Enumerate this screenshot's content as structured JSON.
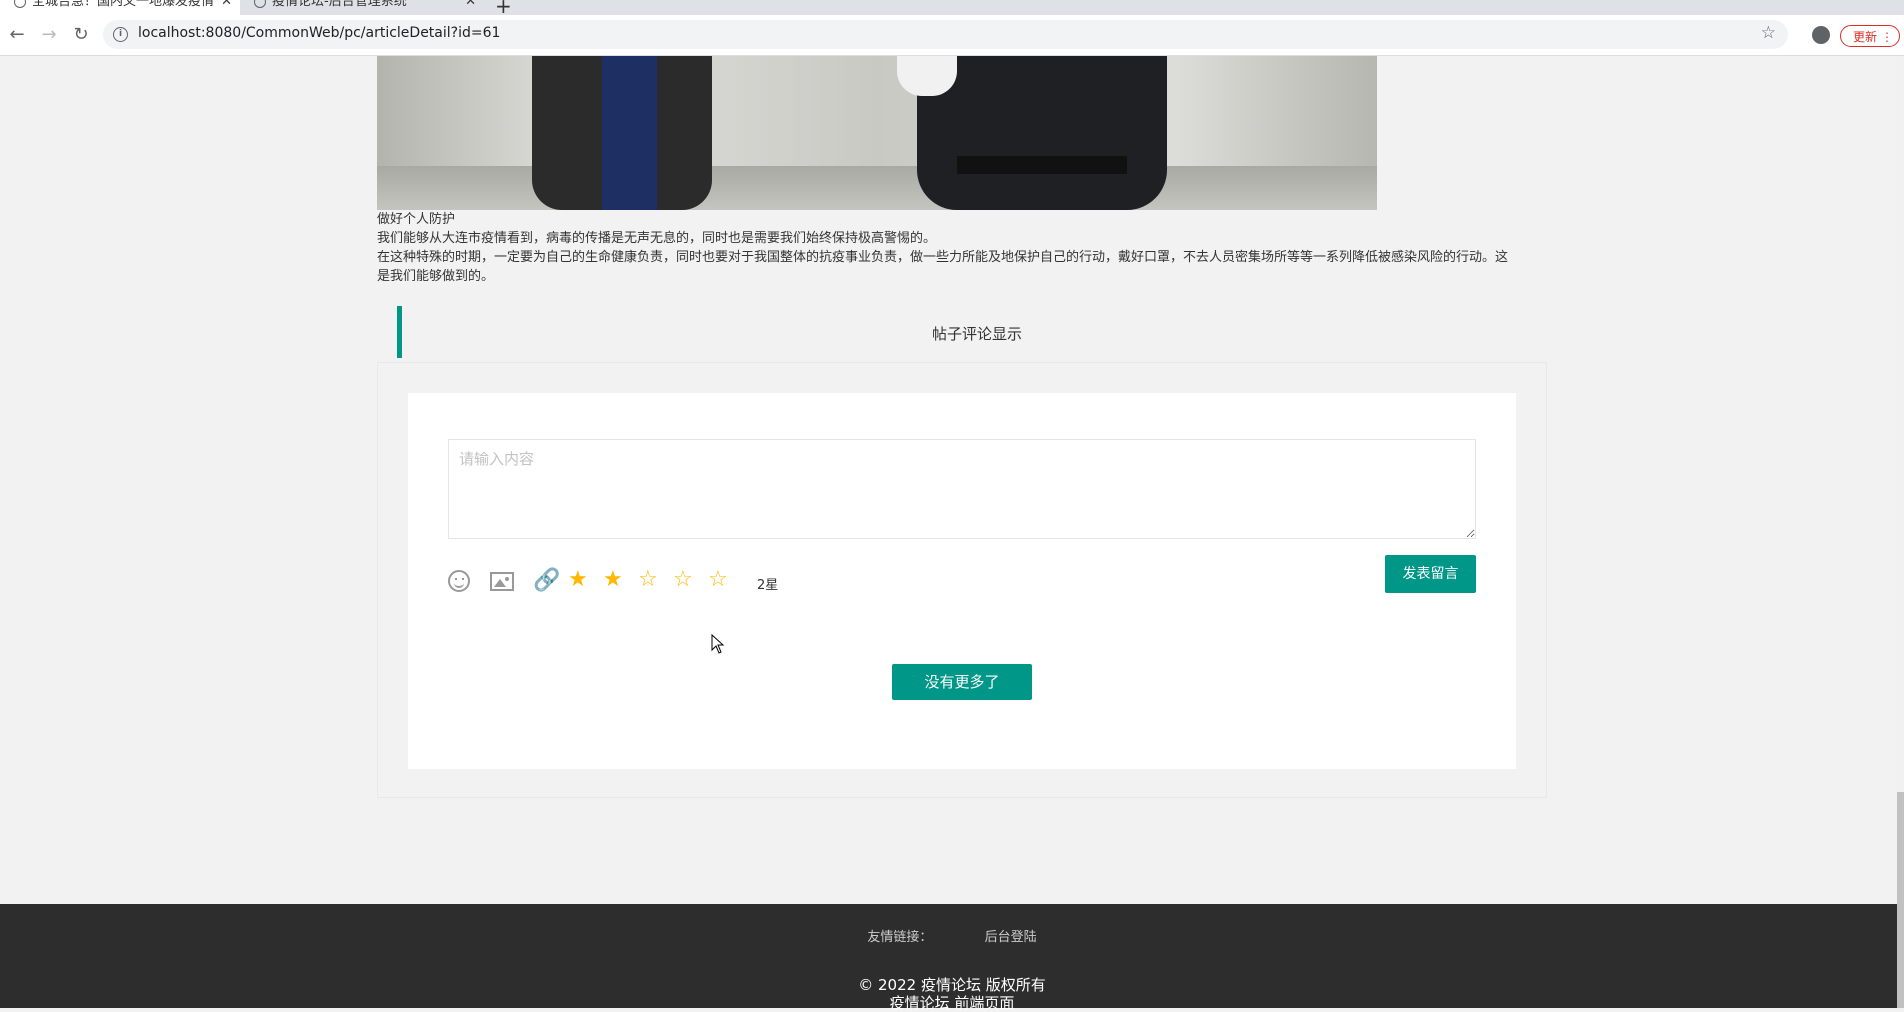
{
  "browser": {
    "tabs": [
      {
        "label": "全城告急！国内又一地爆发疫情",
        "active": true
      },
      {
        "label": "疫情论坛-后台管理系统",
        "active": false
      }
    ],
    "url": "localhost:8080/CommonWeb/pc/articleDetail?id=61",
    "update_label": "更新"
  },
  "article": {
    "paragraphs": [
      "做好个人防护",
      "我们能够从大连市疫情看到，病毒的传播是无声无息的，同时也是需要我们始终保持极高警惕的。",
      "在这种特殊的时期，一定要为自己的生命健康负责，同时也要对于我国整体的抗疫事业负责，做一些力所能及地保护自己的行动，戴好口罩，不去人员密集场所等等一系列降低被感染风险的行动。这是我们能够做到的。"
    ]
  },
  "comments": {
    "section_title": "帖子评论显示",
    "input_placeholder": "请输入内容",
    "rating": {
      "value": 2,
      "max": 5,
      "label": "2星"
    },
    "post_button": "发表留言",
    "more_button": "没有更多了"
  },
  "footer": {
    "links_label": "友情链接：",
    "admin_login": "后台登陆",
    "copyright": "© 2022 疫情论坛 版权所有",
    "subtitle": "疫情论坛 前端页面"
  },
  "colors": {
    "accent": "#009688",
    "star": "#ffb800",
    "footer_bg": "#2d2d2d"
  }
}
